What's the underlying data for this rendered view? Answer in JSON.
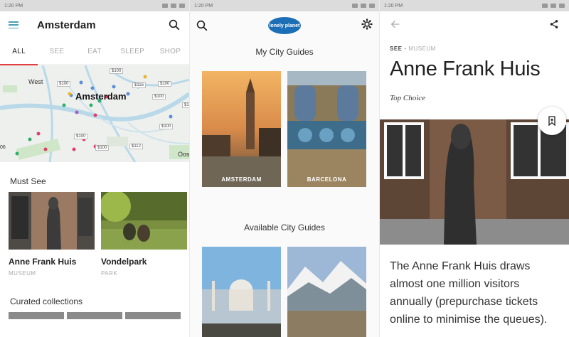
{
  "status": {
    "time_left": "1:20 PM",
    "time_mid": "1:20 PM",
    "time_right": "1:20 PM"
  },
  "screen1": {
    "title": "Amsterdam",
    "tabs": [
      {
        "label": "ALL",
        "active": true
      },
      {
        "label": "SEE",
        "active": false
      },
      {
        "label": "EAT",
        "active": false
      },
      {
        "label": "SLEEP",
        "active": false
      },
      {
        "label": "SHOP",
        "active": false
      }
    ],
    "map": {
      "city": "Amsterdam",
      "labels": [
        "West",
        "Oos",
        "06"
      ],
      "prices": [
        "$100",
        "$100",
        "$116",
        "$100",
        "$100",
        "$100",
        "$100",
        "$100",
        "$112",
        "$1("
      ]
    },
    "must_see_heading": "Must See",
    "cards": [
      {
        "title": "Anne Frank Huis",
        "sub": "MUSEUM"
      },
      {
        "title": "Vondelpark",
        "sub": "PARK"
      }
    ],
    "curated_heading": "Curated collections"
  },
  "screen2": {
    "logo": "lonely planet",
    "my_guides_heading": "My City Guides",
    "my_guides": [
      {
        "label": "AMSTERDAM"
      },
      {
        "label": "BARCELONA"
      }
    ],
    "available_heading": "Available City Guides"
  },
  "screen3": {
    "breadcrumb_primary": "SEE",
    "breadcrumb_sep": " • ",
    "breadcrumb_secondary": "MUSEUM",
    "title": "Anne Frank Huis",
    "top_choice": "Top Choice",
    "description": "The Anne Frank Huis draws almost one million visitors annually (prepurchase tickets online to minimise the queues)."
  },
  "colors": {
    "accent": "#e04040",
    "menu": "#4a9fb5",
    "logo": "#1c6fb7"
  }
}
